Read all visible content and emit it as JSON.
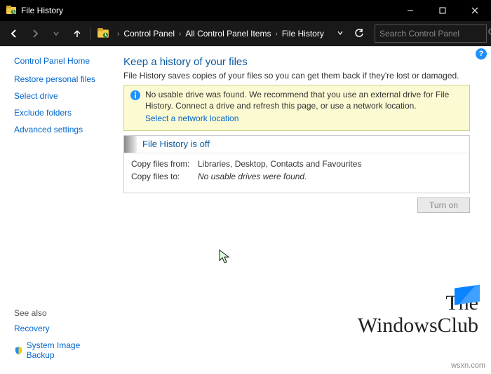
{
  "window": {
    "title": "File History"
  },
  "breadcrumb": {
    "items": [
      "Control Panel",
      "All Control Panel Items",
      "File History"
    ]
  },
  "search": {
    "placeholder": "Search Control Panel"
  },
  "sidebar": {
    "heading": "Control Panel Home",
    "links": [
      "Restore personal files",
      "Select drive",
      "Exclude folders",
      "Advanced settings"
    ],
    "see_also_heading": "See also",
    "see_also_links": [
      "Recovery",
      "System Image Backup"
    ]
  },
  "main": {
    "title": "Keep a history of your files",
    "subtitle": "File History saves copies of your files so you can get them back if they're lost or damaged."
  },
  "infobox": {
    "text": "No usable drive was found. We recommend that you use an external drive for File History. Connect a drive and refresh this page, or use a network location.",
    "link": "Select a network location"
  },
  "status": {
    "title": "File History is off",
    "rows": [
      {
        "key": "Copy files from:",
        "val": "Libraries, Desktop, Contacts and Favourites",
        "italic": false
      },
      {
        "key": "Copy files to:",
        "val": "No usable drives were found.",
        "italic": true
      }
    ]
  },
  "actions": {
    "turn_on": "Turn on"
  },
  "help": {
    "label": "?"
  },
  "watermark": {
    "line1": "The",
    "line2": "WindowsClub"
  },
  "footer": {
    "site": "wsxn.com"
  }
}
